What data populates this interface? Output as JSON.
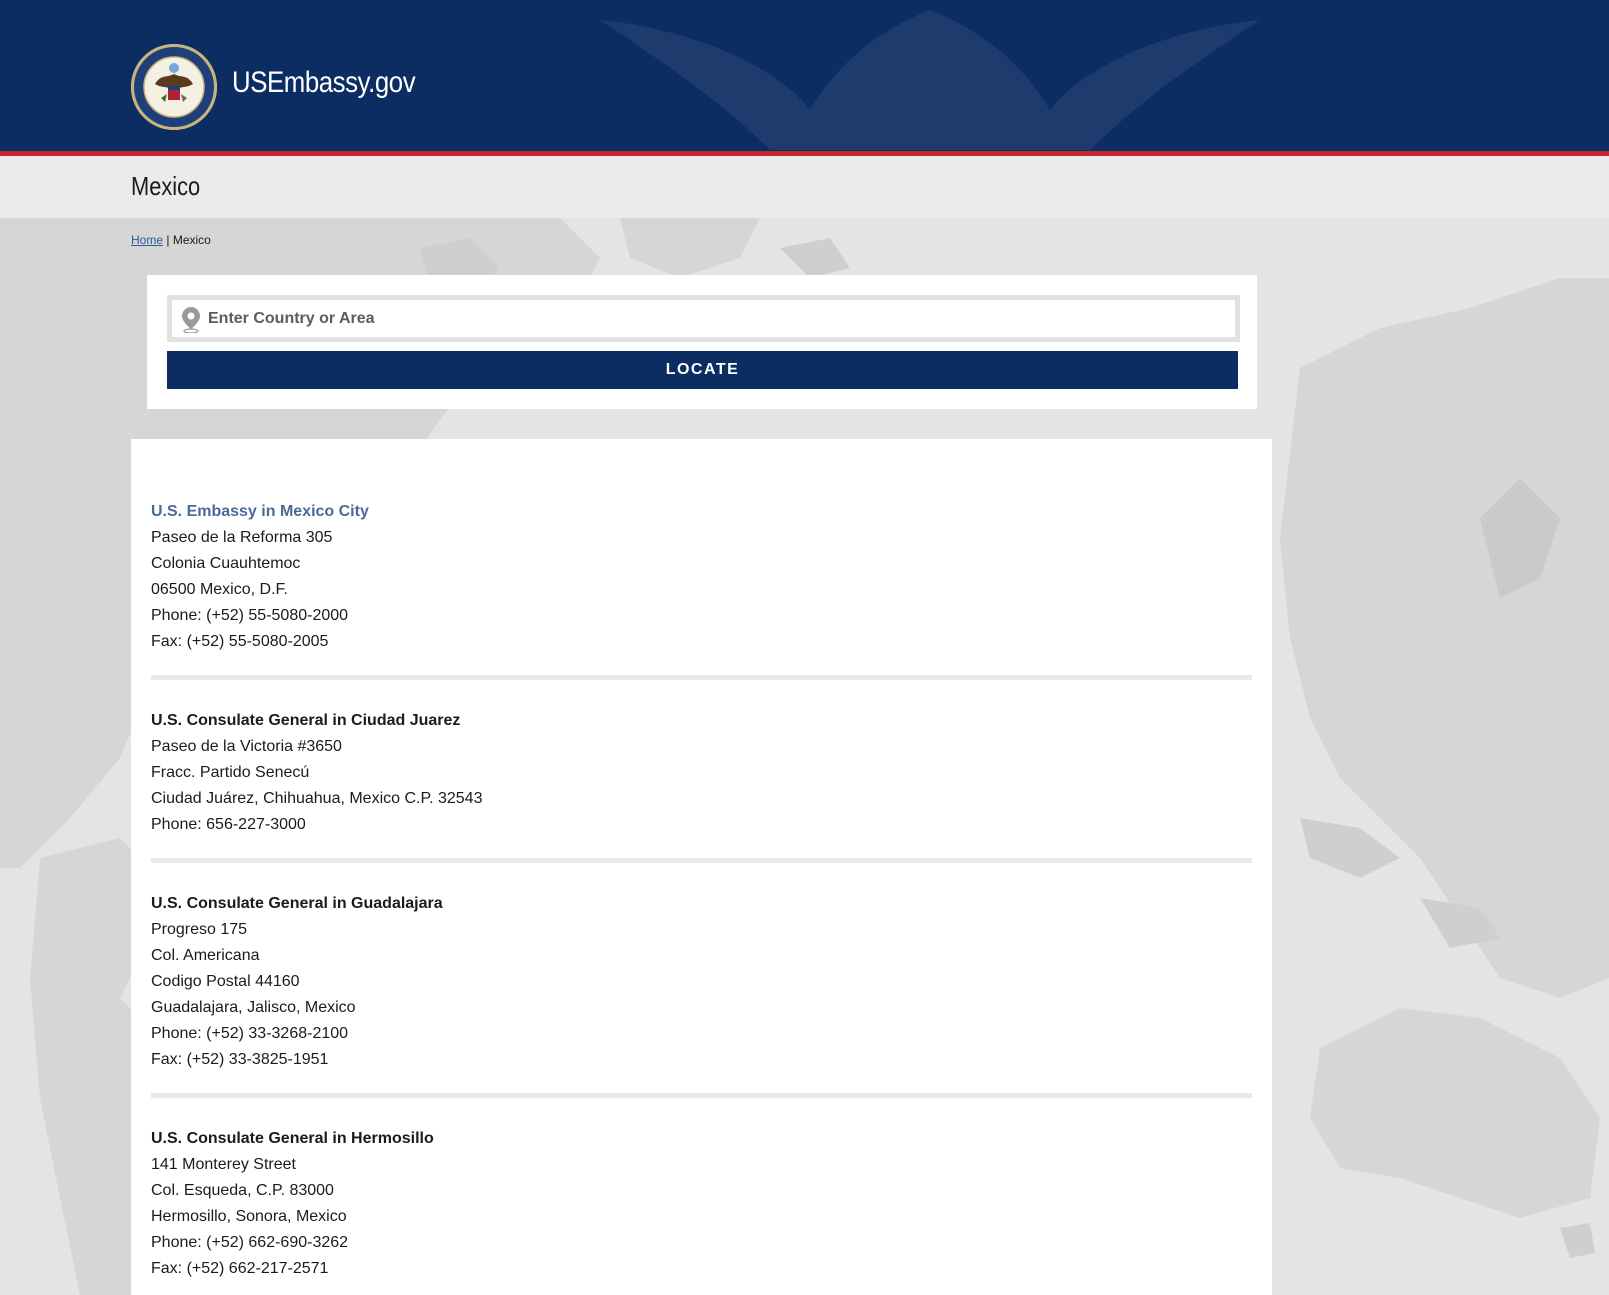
{
  "header": {
    "site_title": "USEmbassy.gov",
    "seal_icon": "department-of-state-seal",
    "background_color": "#0b2d62",
    "accent_stripe_color": "#c1272d"
  },
  "page": {
    "title": "Mexico"
  },
  "breadcrumb": {
    "home_label": "Home",
    "separator": "|",
    "current": "Mexico"
  },
  "search": {
    "icon": "map-pin-icon",
    "placeholder": "Enter Country or Area",
    "value": "",
    "button_label": "LOCATE"
  },
  "posts": [
    {
      "title": "U.S. Embassy in Mexico City",
      "is_link": true,
      "lines": [
        "Paseo de la Reforma 305",
        "Colonia Cuauhtemoc",
        "06500 Mexico, D.F.",
        "Phone: (+52) 55-5080-2000",
        "Fax: (+52) 55-5080-2005"
      ]
    },
    {
      "title": "U.S. Consulate General in Ciudad Juarez",
      "is_link": false,
      "lines": [
        "Paseo de la Victoria #3650",
        "Fracc. Partido Senecú",
        "Ciudad Juárez, Chihuahua, Mexico C.P. 32543",
        "Phone: 656-227-3000"
      ]
    },
    {
      "title": "U.S. Consulate General in Guadalajara",
      "is_link": false,
      "lines": [
        "Progreso 175",
        "Col. Americana",
        "Codigo Postal 44160",
        "Guadalajara, Jalisco, Mexico",
        "Phone: (+52) 33-3268-2100",
        "Fax: (+52) 33-3825-1951"
      ]
    },
    {
      "title": "U.S. Consulate General in Hermosillo",
      "is_link": false,
      "lines": [
        "141 Monterey Street",
        "Col. Esqueda, C.P. 83000",
        "Hermosillo, Sonora, Mexico",
        "Phone: (+52) 662-690-3262",
        "Fax: (+52) 662-217-2571"
      ]
    }
  ]
}
